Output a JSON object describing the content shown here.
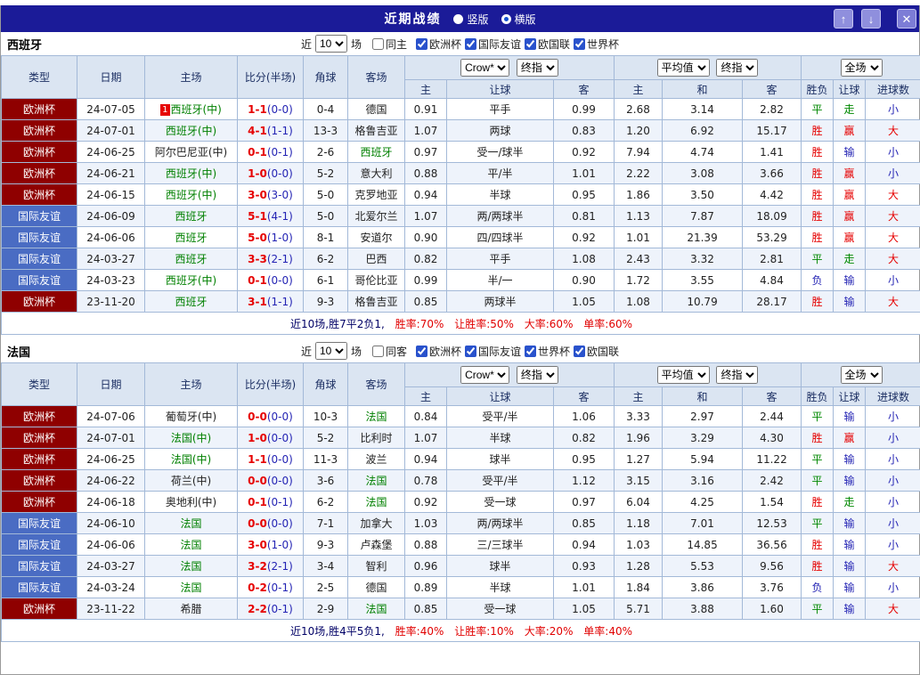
{
  "titlebar": {
    "title": "近期战绩",
    "vertical": "竖版",
    "horizontal": "横版",
    "selected": "横版"
  },
  "icons": {
    "up": "↑",
    "down": "↓",
    "close": "✕"
  },
  "selects": {
    "provider": "Crow*",
    "final": "终指",
    "average": "平均值",
    "full": "全场"
  },
  "header": {
    "type": "类型",
    "date": "日期",
    "home": "主场",
    "score": "比分(半场)",
    "corner": "角球",
    "away": "客场",
    "asian_home": "主",
    "asian_handicap": "让球",
    "asian_away": "客",
    "euro_home": "主",
    "euro_draw": "和",
    "euro_away": "客",
    "wdl": "胜负",
    "handicap_result": "让球",
    "goals": "进球数"
  },
  "colors": {
    "red": "#e60000",
    "green": "#008800",
    "blue": "#2424b4",
    "team_green": "#008000",
    "euro_bg": "#8f0000",
    "friendly_bg": "#4a6cc3",
    "titlebar_bg": "#1b1b98",
    "header_bg": "#dbe5f2",
    "alt_row_bg": "#eef3fb",
    "border": "#a3b9d8",
    "button_bg": "#8f8fdd",
    "summary_red": "#e10000",
    "summary_prefix": "#000066",
    "score_red": "#e60000",
    "half_blue": "#2424b4"
  },
  "sections": [
    {
      "team": "西班牙",
      "filter": {
        "near": "近",
        "count": "10",
        "games": "场",
        "same": "同主",
        "same_checked": false,
        "comps": [
          "欧洲杯",
          "国际友谊",
          "欧国联",
          "世界杯"
        ],
        "comps_checked": [
          true,
          true,
          true,
          true
        ]
      },
      "rows": [
        {
          "comp": "欧洲杯",
          "ct": "euro",
          "date": "24-07-05",
          "badge": "1",
          "home": "西班牙(中)",
          "hf": true,
          "score": "1-1",
          "half": "(0-0)",
          "corner": "0-4",
          "away": "德国",
          "af": false,
          "o1": "0.91",
          "hcap": "平手",
          "o2": "0.99",
          "eu": [
            "2.68",
            "3.14",
            "2.82"
          ],
          "res": [
            "平",
            "green"
          ],
          "hres": [
            "走",
            "green"
          ],
          "goals": [
            "小",
            "blue"
          ]
        },
        {
          "comp": "欧洲杯",
          "ct": "euro",
          "date": "24-07-01",
          "home": "西班牙(中)",
          "hf": true,
          "score": "4-1",
          "half": "(1-1)",
          "corner": "13-3",
          "away": "格鲁吉亚",
          "af": false,
          "o1": "1.07",
          "hcap": "两球",
          "o2": "0.83",
          "eu": [
            "1.20",
            "6.92",
            "15.17"
          ],
          "res": [
            "胜",
            "red"
          ],
          "hres": [
            "赢",
            "red"
          ],
          "goals": [
            "大",
            "red"
          ]
        },
        {
          "comp": "欧洲杯",
          "ct": "euro",
          "date": "24-06-25",
          "home": "阿尔巴尼亚(中)",
          "hf": false,
          "score": "0-1",
          "half": "(0-1)",
          "corner": "2-6",
          "away": "西班牙",
          "af": true,
          "o1": "0.97",
          "hcap": "受一/球半",
          "o2": "0.92",
          "eu": [
            "7.94",
            "4.74",
            "1.41"
          ],
          "res": [
            "胜",
            "red"
          ],
          "hres": [
            "输",
            "blue"
          ],
          "goals": [
            "小",
            "blue"
          ]
        },
        {
          "comp": "欧洲杯",
          "ct": "euro",
          "date": "24-06-21",
          "home": "西班牙(中)",
          "hf": true,
          "score": "1-0",
          "half": "(0-0)",
          "corner": "5-2",
          "away": "意大利",
          "af": false,
          "o1": "0.88",
          "hcap": "平/半",
          "o2": "1.01",
          "eu": [
            "2.22",
            "3.08",
            "3.66"
          ],
          "res": [
            "胜",
            "red"
          ],
          "hres": [
            "赢",
            "red"
          ],
          "goals": [
            "小",
            "blue"
          ]
        },
        {
          "comp": "欧洲杯",
          "ct": "euro",
          "date": "24-06-15",
          "home": "西班牙(中)",
          "hf": true,
          "score": "3-0",
          "half": "(3-0)",
          "corner": "5-0",
          "away": "克罗地亚",
          "af": false,
          "o1": "0.94",
          "hcap": "半球",
          "o2": "0.95",
          "eu": [
            "1.86",
            "3.50",
            "4.42"
          ],
          "res": [
            "胜",
            "red"
          ],
          "hres": [
            "赢",
            "red"
          ],
          "goals": [
            "大",
            "red"
          ]
        },
        {
          "comp": "国际友谊",
          "ct": "friendly",
          "date": "24-06-09",
          "home": "西班牙",
          "hf": true,
          "score": "5-1",
          "half": "(4-1)",
          "corner": "5-0",
          "away": "北爱尔兰",
          "af": false,
          "o1": "1.07",
          "hcap": "两/两球半",
          "o2": "0.81",
          "eu": [
            "1.13",
            "7.87",
            "18.09"
          ],
          "res": [
            "胜",
            "red"
          ],
          "hres": [
            "赢",
            "red"
          ],
          "goals": [
            "大",
            "red"
          ]
        },
        {
          "comp": "国际友谊",
          "ct": "friendly",
          "date": "24-06-06",
          "home": "西班牙",
          "hf": true,
          "score": "5-0",
          "half": "(1-0)",
          "corner": "8-1",
          "away": "安道尔",
          "af": false,
          "o1": "0.90",
          "hcap": "四/四球半",
          "o2": "0.92",
          "eu": [
            "1.01",
            "21.39",
            "53.29"
          ],
          "res": [
            "胜",
            "red"
          ],
          "hres": [
            "赢",
            "red"
          ],
          "goals": [
            "大",
            "red"
          ]
        },
        {
          "comp": "国际友谊",
          "ct": "friendly",
          "date": "24-03-27",
          "home": "西班牙",
          "hf": true,
          "score": "3-3",
          "half": "(2-1)",
          "corner": "6-2",
          "away": "巴西",
          "af": false,
          "o1": "0.82",
          "hcap": "平手",
          "o2": "1.08",
          "eu": [
            "2.43",
            "3.32",
            "2.81"
          ],
          "res": [
            "平",
            "green"
          ],
          "hres": [
            "走",
            "green"
          ],
          "goals": [
            "大",
            "red"
          ]
        },
        {
          "comp": "国际友谊",
          "ct": "friendly",
          "date": "24-03-23",
          "home": "西班牙(中)",
          "hf": true,
          "score": "0-1",
          "half": "(0-0)",
          "corner": "6-1",
          "away": "哥伦比亚",
          "af": false,
          "o1": "0.99",
          "hcap": "半/一",
          "o2": "0.90",
          "eu": [
            "1.72",
            "3.55",
            "4.84"
          ],
          "res": [
            "负",
            "blue"
          ],
          "hres": [
            "输",
            "blue"
          ],
          "goals": [
            "小",
            "blue"
          ]
        },
        {
          "comp": "欧洲杯",
          "ct": "euro",
          "date": "23-11-20",
          "home": "西班牙",
          "hf": true,
          "score": "3-1",
          "half": "(1-1)",
          "corner": "9-3",
          "away": "格鲁吉亚",
          "af": false,
          "o1": "0.85",
          "hcap": "两球半",
          "o2": "1.05",
          "eu": [
            "1.08",
            "10.79",
            "28.17"
          ],
          "res": [
            "胜",
            "red"
          ],
          "hres": [
            "输",
            "blue"
          ],
          "goals": [
            "大",
            "red"
          ]
        }
      ],
      "summary": {
        "prefix": "近10场,胜7平2负1,",
        "win": "胜率:70%",
        "handicap": "让胜率:50%",
        "big": "大率:60%",
        "single": "单率:60%"
      }
    },
    {
      "team": "法国",
      "filter": {
        "near": "近",
        "count": "10",
        "games": "场",
        "same": "同客",
        "same_checked": false,
        "comps": [
          "欧洲杯",
          "国际友谊",
          "世界杯",
          "欧国联"
        ],
        "comps_checked": [
          true,
          true,
          true,
          true
        ]
      },
      "rows": [
        {
          "comp": "欧洲杯",
          "ct": "euro",
          "date": "24-07-06",
          "home": "葡萄牙(中)",
          "hf": false,
          "score": "0-0",
          "half": "(0-0)",
          "corner": "10-3",
          "away": "法国",
          "af": true,
          "o1": "0.84",
          "hcap": "受平/半",
          "o2": "1.06",
          "eu": [
            "3.33",
            "2.97",
            "2.44"
          ],
          "res": [
            "平",
            "green"
          ],
          "hres": [
            "输",
            "blue"
          ],
          "goals": [
            "小",
            "blue"
          ]
        },
        {
          "comp": "欧洲杯",
          "ct": "euro",
          "date": "24-07-01",
          "home": "法国(中)",
          "hf": true,
          "score": "1-0",
          "half": "(0-0)",
          "corner": "5-2",
          "away": "比利时",
          "af": false,
          "o1": "1.07",
          "hcap": "半球",
          "o2": "0.82",
          "eu": [
            "1.96",
            "3.29",
            "4.30"
          ],
          "res": [
            "胜",
            "red"
          ],
          "hres": [
            "赢",
            "red"
          ],
          "goals": [
            "小",
            "blue"
          ]
        },
        {
          "comp": "欧洲杯",
          "ct": "euro",
          "date": "24-06-25",
          "home": "法国(中)",
          "hf": true,
          "score": "1-1",
          "half": "(0-0)",
          "corner": "11-3",
          "away": "波兰",
          "af": false,
          "o1": "0.94",
          "hcap": "球半",
          "o2": "0.95",
          "eu": [
            "1.27",
            "5.94",
            "11.22"
          ],
          "res": [
            "平",
            "green"
          ],
          "hres": [
            "输",
            "blue"
          ],
          "goals": [
            "小",
            "blue"
          ]
        },
        {
          "comp": "欧洲杯",
          "ct": "euro",
          "date": "24-06-22",
          "home": "荷兰(中)",
          "hf": false,
          "score": "0-0",
          "half": "(0-0)",
          "corner": "3-6",
          "away": "法国",
          "af": true,
          "o1": "0.78",
          "hcap": "受平/半",
          "o2": "1.12",
          "eu": [
            "3.15",
            "3.16",
            "2.42"
          ],
          "res": [
            "平",
            "green"
          ],
          "hres": [
            "输",
            "blue"
          ],
          "goals": [
            "小",
            "blue"
          ]
        },
        {
          "comp": "欧洲杯",
          "ct": "euro",
          "date": "24-06-18",
          "home": "奥地利(中)",
          "hf": false,
          "score": "0-1",
          "half": "(0-1)",
          "corner": "6-2",
          "away": "法国",
          "af": true,
          "o1": "0.92",
          "hcap": "受一球",
          "o2": "0.97",
          "eu": [
            "6.04",
            "4.25",
            "1.54"
          ],
          "res": [
            "胜",
            "red"
          ],
          "hres": [
            "走",
            "green"
          ],
          "goals": [
            "小",
            "blue"
          ]
        },
        {
          "comp": "国际友谊",
          "ct": "friendly",
          "date": "24-06-10",
          "home": "法国",
          "hf": true,
          "score": "0-0",
          "half": "(0-0)",
          "corner": "7-1",
          "away": "加拿大",
          "af": false,
          "o1": "1.03",
          "hcap": "两/两球半",
          "o2": "0.85",
          "eu": [
            "1.18",
            "7.01",
            "12.53"
          ],
          "res": [
            "平",
            "green"
          ],
          "hres": [
            "输",
            "blue"
          ],
          "goals": [
            "小",
            "blue"
          ]
        },
        {
          "comp": "国际友谊",
          "ct": "friendly",
          "date": "24-06-06",
          "home": "法国",
          "hf": true,
          "score": "3-0",
          "half": "(1-0)",
          "corner": "9-3",
          "away": "卢森堡",
          "af": false,
          "o1": "0.88",
          "hcap": "三/三球半",
          "o2": "0.94",
          "eu": [
            "1.03",
            "14.85",
            "36.56"
          ],
          "res": [
            "胜",
            "red"
          ],
          "hres": [
            "输",
            "blue"
          ],
          "goals": [
            "小",
            "blue"
          ]
        },
        {
          "comp": "国际友谊",
          "ct": "friendly",
          "date": "24-03-27",
          "home": "法国",
          "hf": true,
          "score": "3-2",
          "half": "(2-1)",
          "corner": "3-4",
          "away": "智利",
          "af": false,
          "o1": "0.96",
          "hcap": "球半",
          "o2": "0.93",
          "eu": [
            "1.28",
            "5.53",
            "9.56"
          ],
          "res": [
            "胜",
            "red"
          ],
          "hres": [
            "输",
            "blue"
          ],
          "goals": [
            "大",
            "red"
          ]
        },
        {
          "comp": "国际友谊",
          "ct": "friendly",
          "date": "24-03-24",
          "home": "法国",
          "hf": true,
          "score": "0-2",
          "half": "(0-1)",
          "corner": "2-5",
          "away": "德国",
          "af": false,
          "o1": "0.89",
          "hcap": "半球",
          "o2": "1.01",
          "eu": [
            "1.84",
            "3.86",
            "3.76"
          ],
          "res": [
            "负",
            "blue"
          ],
          "hres": [
            "输",
            "blue"
          ],
          "goals": [
            "小",
            "blue"
          ]
        },
        {
          "comp": "欧洲杯",
          "ct": "euro",
          "date": "23-11-22",
          "home": "希腊",
          "hf": false,
          "score": "2-2",
          "half": "(0-1)",
          "corner": "2-9",
          "away": "法国",
          "af": true,
          "o1": "0.85",
          "hcap": "受一球",
          "o2": "1.05",
          "eu": [
            "5.71",
            "3.88",
            "1.60"
          ],
          "res": [
            "平",
            "green"
          ],
          "hres": [
            "输",
            "blue"
          ],
          "goals": [
            "大",
            "red"
          ]
        }
      ],
      "summary": {
        "prefix": "近10场,胜4平5负1,",
        "win": "胜率:40%",
        "handicap": "让胜率:10%",
        "big": "大率:20%",
        "single": "单率:40%"
      }
    }
  ]
}
